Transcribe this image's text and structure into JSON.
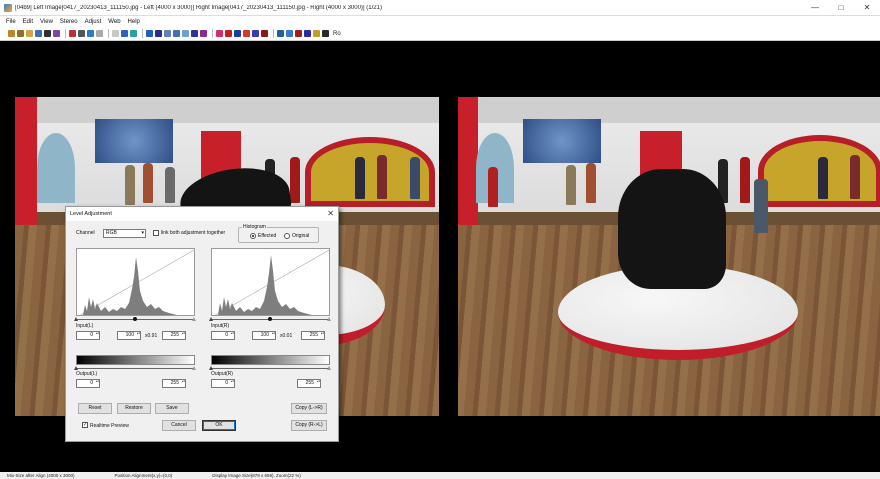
{
  "window": {
    "title": "[04b9] Left Image[0417_20230413_111150.jpg - Left (4000 x 3000)] Right Image[0417_20230413_111150.jpg - Right (4000 x 3000)] (1/21)",
    "minimize": "—",
    "maximize": "□",
    "close": "✕"
  },
  "menu": [
    "File",
    "Edit",
    "View",
    "Stereo",
    "Adjust",
    "Web",
    "Help"
  ],
  "toolbar": {
    "icon_colors": [
      "#b8862b",
      "#9a6a2a",
      "#d4a34a",
      "#3b6fb5",
      "#2f2f2f",
      "#7a4a9a",
      "#c03030",
      "#555555",
      "#2a7ad0",
      "#aaaaaa",
      "#c8c8c8",
      "#3060c0",
      "#2aa0a0",
      "#1e5fbf",
      "#2b2b8a",
      "#6080c0",
      "#4070b0",
      "#70a0d0",
      "#3030a0",
      "#8a2a8a",
      "#d03070",
      "#c02020",
      "#1a3f9a",
      "#d43a2a",
      "#3a3ab0",
      "#8a1a1a",
      "#2060a0",
      "#3a7ad0",
      "#a02020",
      "#2a2aa0",
      "#c0a020",
      "#2a2a2a"
    ],
    "last_label": "Ro"
  },
  "dialog": {
    "title": "Level Adjustment",
    "close": "✕",
    "channel_label": "Channel",
    "channel_value": "RGB",
    "link_label": "link both adjustment together",
    "histogram_group": "Histogram",
    "radio_effected": "Effected",
    "radio_original": "Original",
    "left": {
      "input_label": "Input(L)",
      "in_black": "0",
      "in_mid": "100",
      "gamma": "x0.91",
      "in_white": "255",
      "output_label": "Output(L)",
      "out_black": "0",
      "out_white": "255"
    },
    "right": {
      "input_label": "Input(R)",
      "in_black": "0",
      "in_mid": "100",
      "gamma": "x0.01",
      "in_white": "255",
      "output_label": "Output(R)",
      "out_black": "0",
      "out_white": "255"
    },
    "buttons": {
      "reset": "Reset",
      "restore": "Restore",
      "save": "Save",
      "copy_lr": "Copy (L->R)",
      "copy_rl": "Copy (R->L)",
      "cancel": "Cancel",
      "ok": "OK"
    },
    "realtime_label": "Realtime Preview",
    "realtime_checked": "✓"
  },
  "status": {
    "left": "Mix-Size after Align (4000 x 3000)",
    "mid": "Position Alignment(x,y)=(0,0)",
    "right": "Display Image Size(879 x 659), Zoom(22 %)"
  }
}
